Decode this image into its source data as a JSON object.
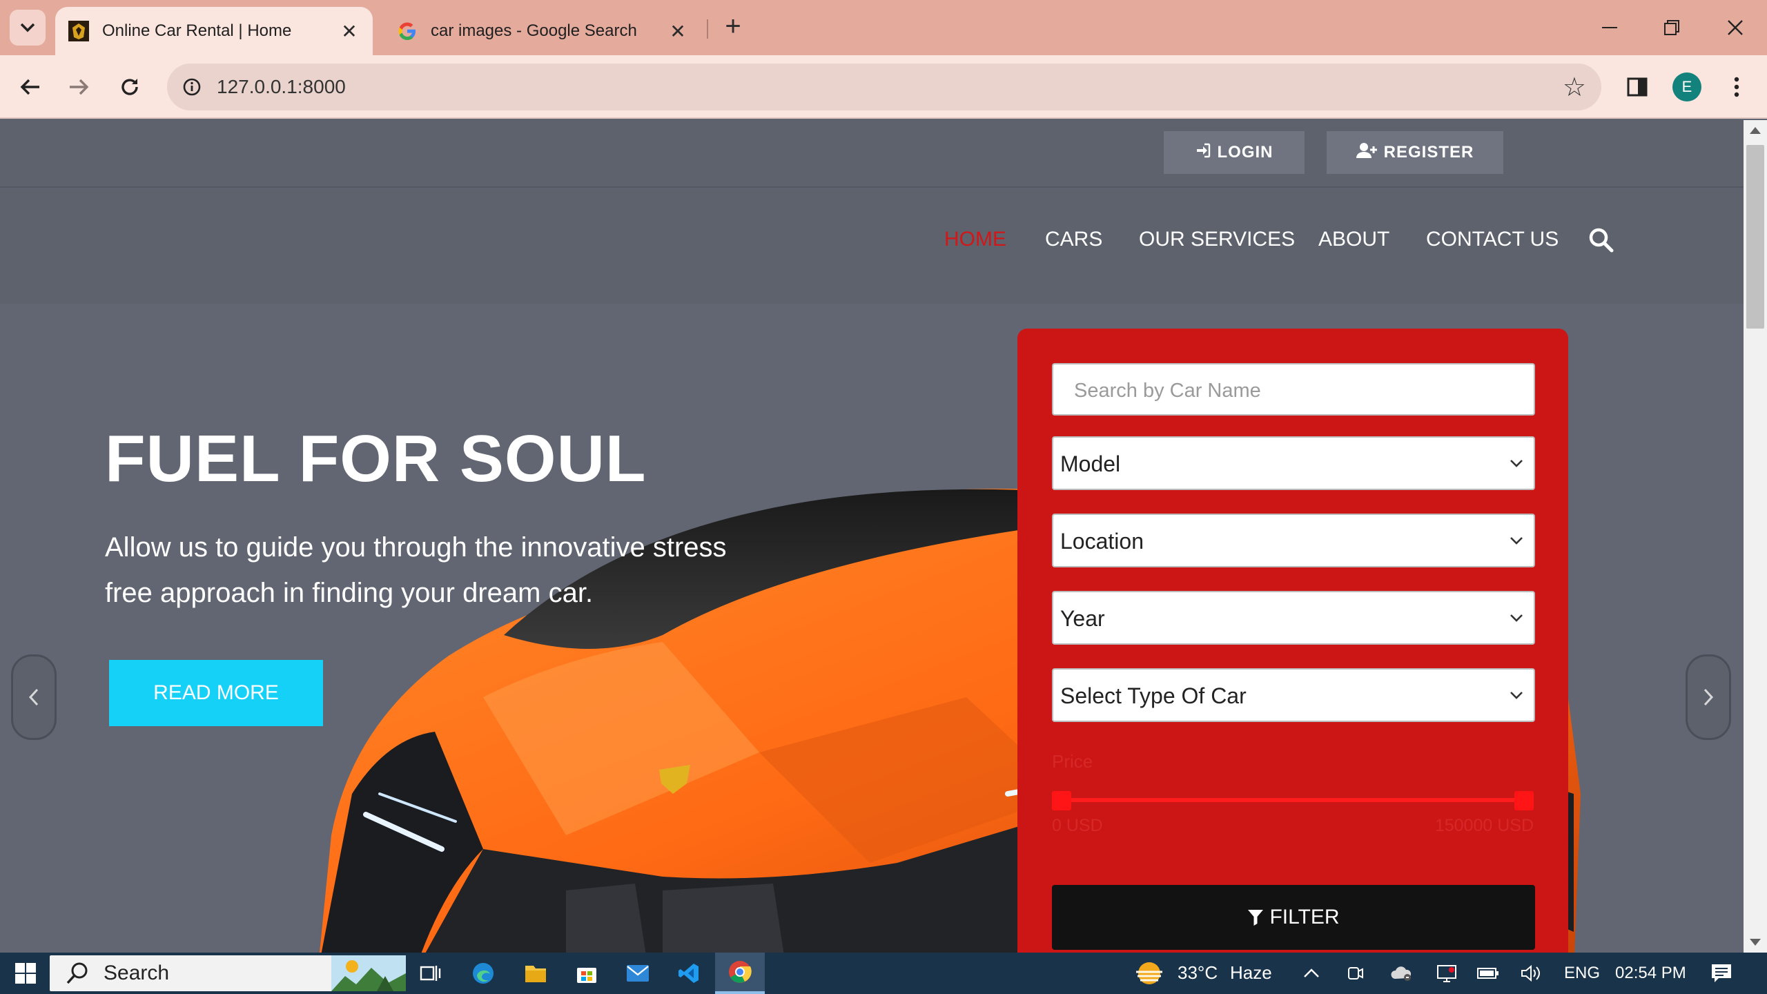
{
  "browser": {
    "tabs": [
      {
        "title": "Online Car Rental | Home",
        "active": true
      },
      {
        "title": "car images - Google Search",
        "active": false
      }
    ],
    "url": "127.0.0.1:8000",
    "profile_initial": "E"
  },
  "site": {
    "topbar": {
      "login_label": "LOGIN",
      "register_label": "REGISTER"
    },
    "nav": {
      "items": [
        "HOME",
        "CARS",
        "OUR SERVICES",
        "ABOUT",
        "CONTACT US"
      ],
      "active": "HOME"
    },
    "hero": {
      "title": "FUEL FOR SOUL",
      "subtitle": "Allow us to guide you through the innovative stress free approach in finding your dream car.",
      "cta_label": "READ MORE"
    },
    "filter": {
      "search_placeholder": "Search by Car Name",
      "model": "Model",
      "location": "Location",
      "year": "Year",
      "car_type": "Select Type Of Car",
      "price_label": "Price",
      "price_min": "0 USD",
      "price_max": "150000 USD",
      "price_range_selected": [
        0,
        1
      ],
      "button_label": "FILTER"
    },
    "colors": {
      "accent_red": "#cc1616",
      "nav_active": "#d11717",
      "cta_cyan": "#16d1f7",
      "car_orange": "#ff6a14"
    }
  },
  "taskbar": {
    "search_label": "Search",
    "weather_temp": "33°C",
    "weather_desc": "Haze",
    "language": "ENG",
    "time": "02:54 PM"
  }
}
